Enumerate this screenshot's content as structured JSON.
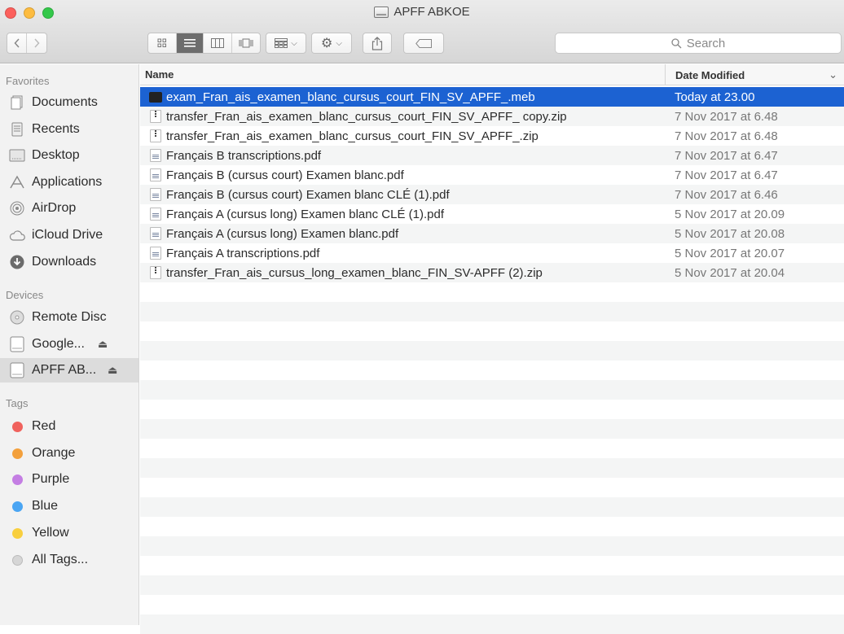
{
  "window": {
    "title": "APFF ABKOE"
  },
  "toolbar": {
    "search_placeholder": "Search"
  },
  "sidebar": {
    "favorites_header": "Favorites",
    "favorites": [
      {
        "label": "Documents",
        "icon": "documents-icon"
      },
      {
        "label": "Recents",
        "icon": "recents-icon"
      },
      {
        "label": "Desktop",
        "icon": "desktop-icon"
      },
      {
        "label": "Applications",
        "icon": "applications-icon"
      },
      {
        "label": "AirDrop",
        "icon": "airdrop-icon"
      },
      {
        "label": "iCloud Drive",
        "icon": "cloud-icon"
      },
      {
        "label": "Downloads",
        "icon": "downloads-icon"
      }
    ],
    "devices_header": "Devices",
    "devices": [
      {
        "label": "Remote Disc",
        "icon": "disc-icon"
      },
      {
        "label": "Google...",
        "icon": "drive-icon"
      },
      {
        "label": "APFF AB...",
        "icon": "drive-icon"
      }
    ],
    "tags_header": "Tags",
    "tags": [
      {
        "label": "Red",
        "color": "#f0625d"
      },
      {
        "label": "Orange",
        "color": "#f3a03c"
      },
      {
        "label": "Purple",
        "color": "#c47ee3"
      },
      {
        "label": "Blue",
        "color": "#4aa5f3"
      },
      {
        "label": "Yellow",
        "color": "#f8cf3f"
      },
      {
        "label": "All Tags...",
        "color": "#d6d6d6"
      }
    ]
  },
  "list": {
    "col_name": "Name",
    "col_date": "Date Modified",
    "rows": [
      {
        "name": "exam_Fran_ais_examen_blanc_cursus_court_FIN_SV_APFF_.meb",
        "date": "Today at 23.00",
        "type": "exec"
      },
      {
        "name": "transfer_Fran_ais_examen_blanc_cursus_court_FIN_SV_APFF_ copy.zip",
        "date": "7 Nov 2017 at 6.48",
        "type": "zip"
      },
      {
        "name": "transfer_Fran_ais_examen_blanc_cursus_court_FIN_SV_APFF_.zip",
        "date": "7 Nov 2017 at 6.48",
        "type": "zip"
      },
      {
        "name": "Français B transcriptions.pdf",
        "date": "7 Nov 2017 at 6.47",
        "type": "pdf"
      },
      {
        "name": "Français B (cursus court) Examen blanc.pdf",
        "date": "7 Nov 2017 at 6.47",
        "type": "pdf"
      },
      {
        "name": "Français B (cursus court) Examen blanc CLÉ (1).pdf",
        "date": "7 Nov 2017 at 6.46",
        "type": "pdf"
      },
      {
        "name": "Français A (cursus long) Examen blanc CLÉ (1).pdf",
        "date": "5 Nov 2017 at 20.09",
        "type": "pdf"
      },
      {
        "name": "Français A (cursus long) Examen blanc.pdf",
        "date": "5 Nov 2017 at 20.08",
        "type": "pdf"
      },
      {
        "name": "Français A transcriptions.pdf",
        "date": "5 Nov 2017 at 20.07",
        "type": "pdf"
      },
      {
        "name": "transfer_Fran_ais_cursus_long_examen_blanc_FIN_SV-APFF (2).zip",
        "date": "5 Nov 2017 at 20.04",
        "type": "zip"
      }
    ]
  }
}
